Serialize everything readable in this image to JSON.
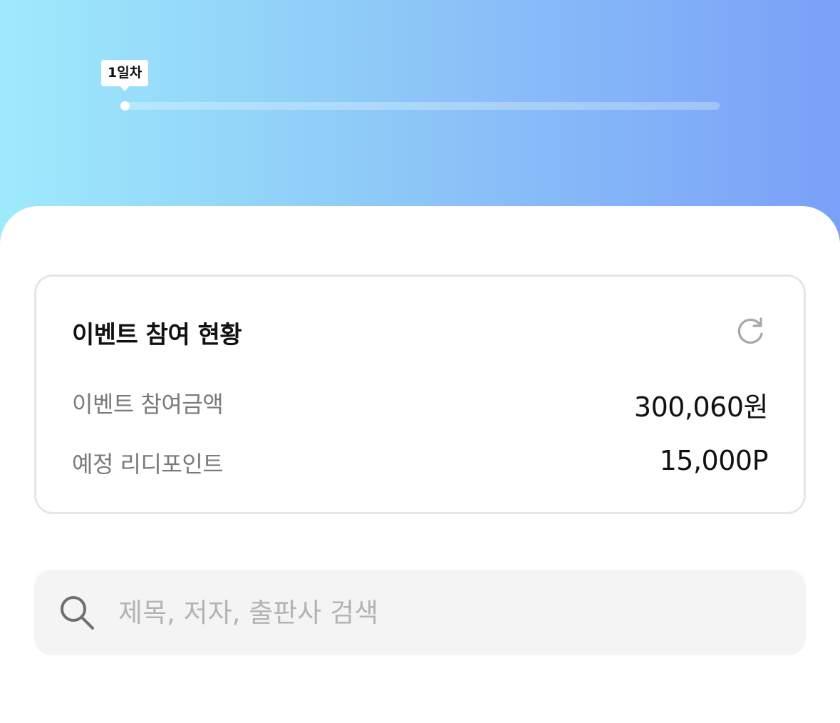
{
  "hero": {
    "tooltip_label": "1일차",
    "progress": 0.006,
    "gradient_colors": [
      "#9eeafc",
      "#8ec9f8",
      "#7aa0f8"
    ]
  },
  "status_card": {
    "title": "이벤트 참여 현황",
    "refresh_icon": "refresh-icon",
    "rows": [
      {
        "label": "이벤트 참여금액",
        "value": "300,060원"
      },
      {
        "label": "예정 리디포인트",
        "value": "15,000P"
      }
    ]
  },
  "search": {
    "icon": "search-icon",
    "placeholder": "제목, 저자, 출판사 검색",
    "value": ""
  },
  "colors": {
    "card_border": "#e6e6e6",
    "label_text": "#7a7a7a",
    "value_text": "#111111",
    "search_bg": "#f4f4f4",
    "placeholder": "#b3b3b3"
  }
}
